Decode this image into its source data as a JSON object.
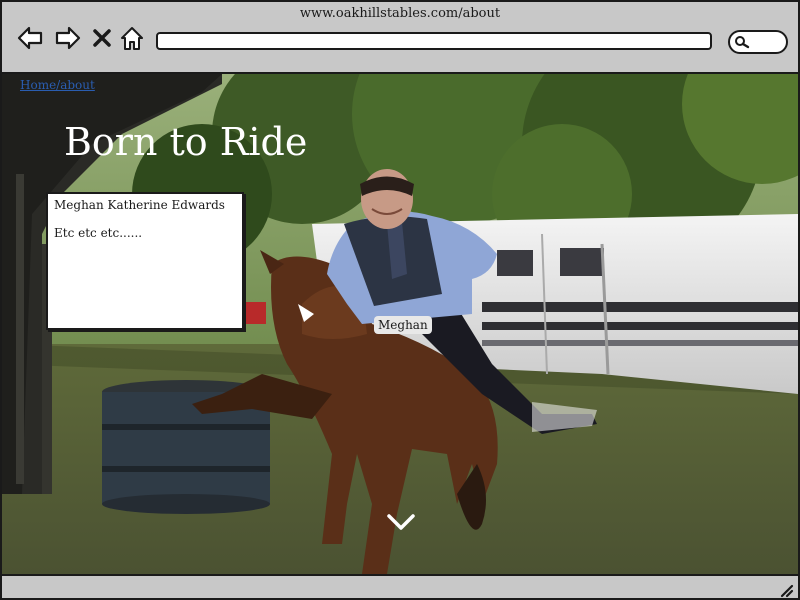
{
  "browser": {
    "title_url": "www.oakhillstables.com/about",
    "address_value": "",
    "icons": {
      "back": "back-arrow-icon",
      "forward": "forward-arrow-icon",
      "stop": "close-icon",
      "home": "home-icon",
      "search": "search-icon",
      "resize": "resize-grip-icon"
    }
  },
  "page": {
    "breadcrumb": "Home/about",
    "hero_title": "Born to Ride",
    "info_box": {
      "name": "Meghan Katherine Edwards",
      "body": "Etc etc etc......"
    },
    "photo_tag": "Meghan",
    "scroll_icon": "chevron-down-icon"
  },
  "colors": {
    "chrome": "#c8c8c8",
    "border": "#1a1a1a",
    "link": "#2a5db0",
    "hero_text": "#ffffff"
  }
}
